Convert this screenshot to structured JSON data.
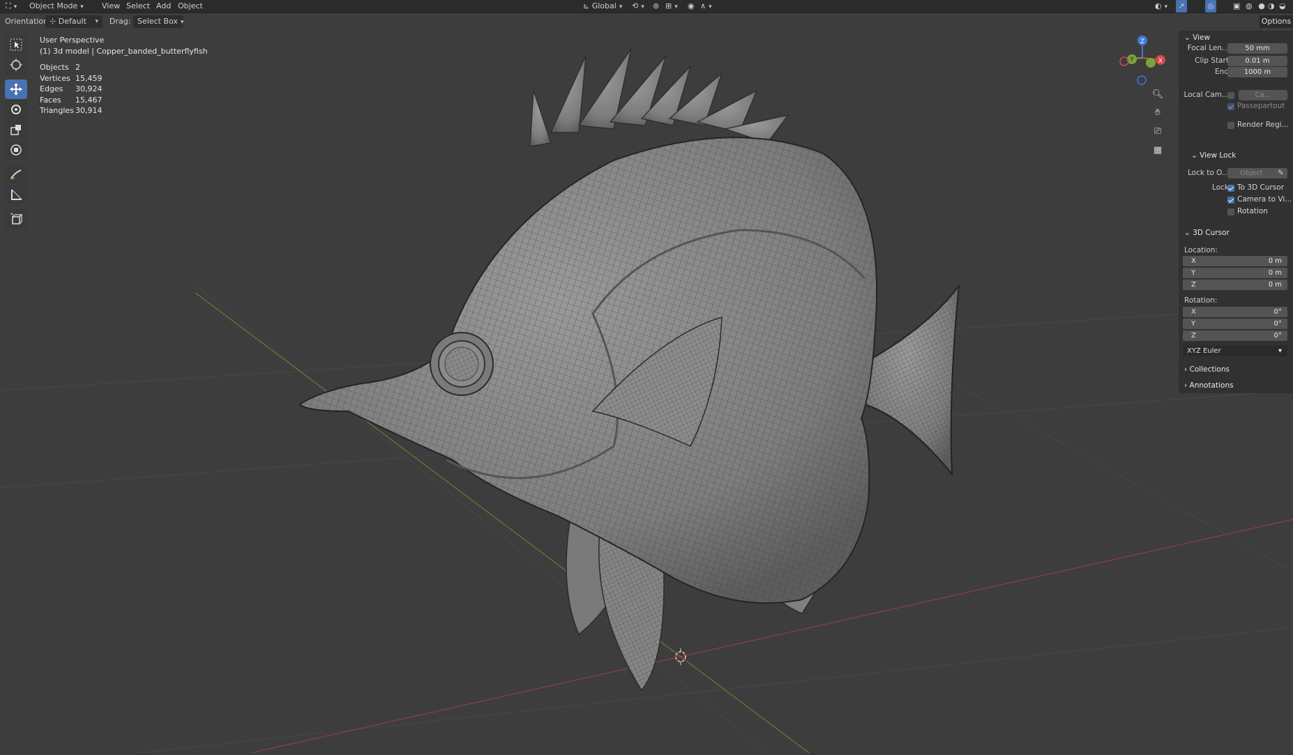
{
  "topbar": {
    "mode": "Object Mode",
    "menus": [
      "View",
      "Select",
      "Add",
      "Object"
    ],
    "transform_orientation": "Global"
  },
  "header": {
    "orientation_label": "Orientation:",
    "orientation_value": "Default",
    "drag_label": "Drag:",
    "drag_value": "Select Box",
    "options_label": "Options"
  },
  "overlay": {
    "view_name": "User Perspective",
    "object_name": "(1) 3d model | Copper_banded_butterflyfish",
    "stats": [
      {
        "key": "Objects",
        "value": "2"
      },
      {
        "key": "Vertices",
        "value": "15,459"
      },
      {
        "key": "Edges",
        "value": "30,924"
      },
      {
        "key": "Faces",
        "value": "15,467"
      },
      {
        "key": "Triangles",
        "value": "30,914"
      }
    ]
  },
  "gizmo": {
    "x": "X",
    "y": "Y",
    "z": "Z"
  },
  "npanel": {
    "view_title": "View",
    "focal_length_label": "Focal Len...",
    "focal_length_value": "50 mm",
    "clip_start_label": "Clip Start",
    "clip_start_value": "0.01 m",
    "clip_end_label": "End",
    "clip_end_value": "1000 m",
    "local_camera_label": "Local Cam...",
    "local_camera_value": "Ca...",
    "passepartout_label": "Passepartout",
    "render_region_label": "Render Regi...",
    "view_lock_title": "View Lock",
    "lock_to_object_label": "Lock to O...",
    "lock_to_object_placeholder": "Object",
    "lock_label": "Lock",
    "lock_3d_cursor_label": "To 3D Cursor",
    "lock_camera_label": "Camera to Vi...",
    "lock_rotation_label": "Rotation",
    "cursor_title": "3D Cursor",
    "location_label": "Location:",
    "location": [
      {
        "axis": "X",
        "value": "0 m"
      },
      {
        "axis": "Y",
        "value": "0 m"
      },
      {
        "axis": "Z",
        "value": "0 m"
      }
    ],
    "rotation_label": "Rotation:",
    "rotation": [
      {
        "axis": "X",
        "value": "0°"
      },
      {
        "axis": "Y",
        "value": "0°"
      },
      {
        "axis": "Z",
        "value": "0°"
      }
    ],
    "rotation_mode": "XYZ Euler",
    "collections_title": "Collections",
    "annotations_title": "Annotations"
  },
  "colors": {
    "accent": "#4772b3",
    "axis_x": "#d44b4b",
    "axis_y": "#7aa33b",
    "axis_z": "#3f79d6"
  }
}
